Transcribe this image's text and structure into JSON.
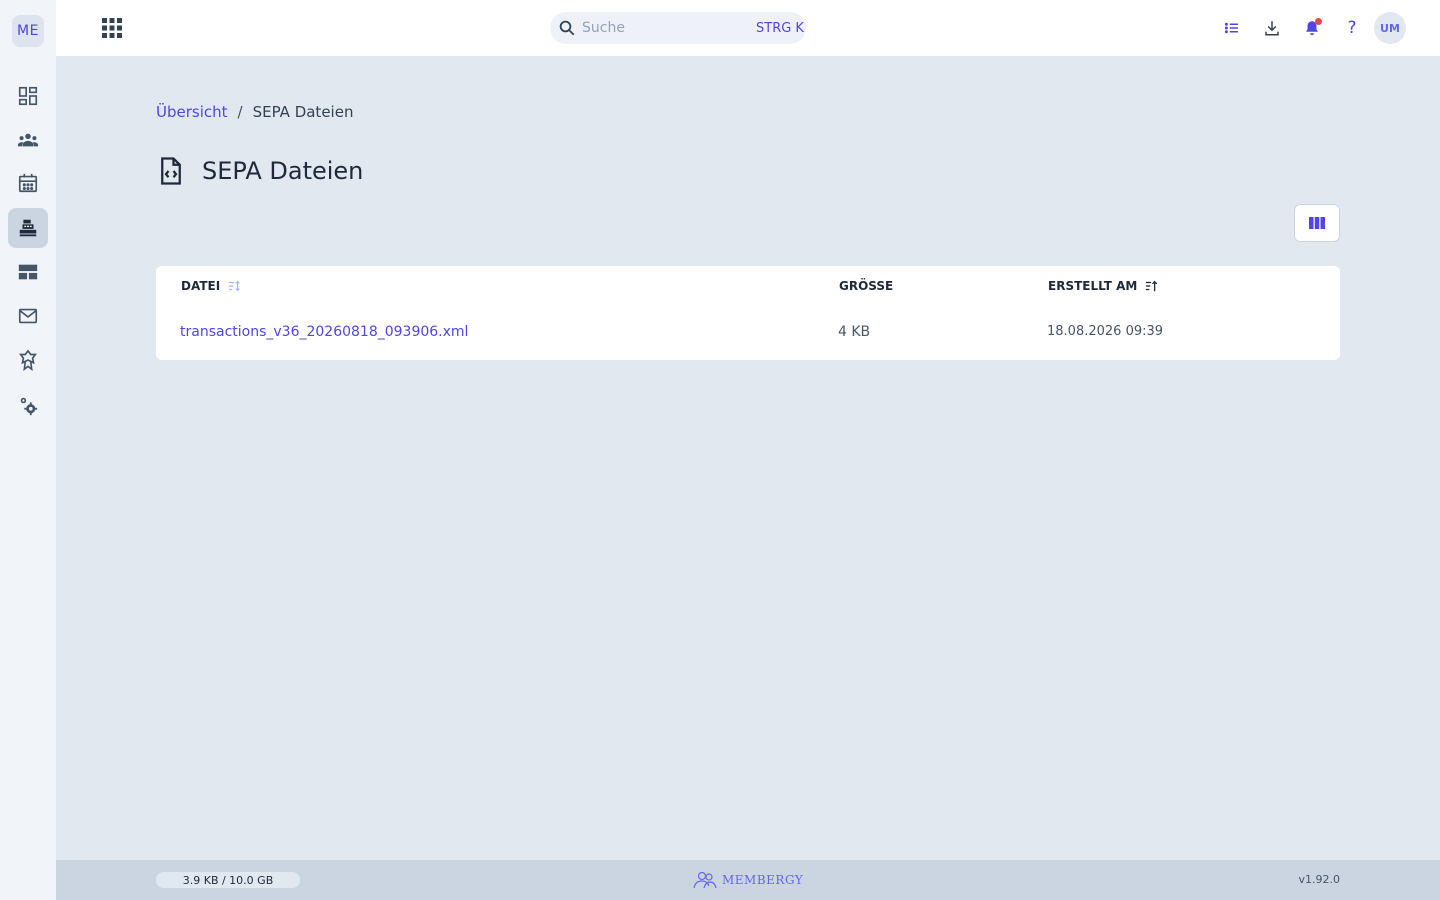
{
  "sidebar": {
    "logo": "ME",
    "items": [
      {
        "icon": "dashboard-icon"
      },
      {
        "icon": "members-icon"
      },
      {
        "icon": "calendar-icon"
      },
      {
        "icon": "cash-register-icon",
        "active": true
      },
      {
        "icon": "layout-icon"
      },
      {
        "icon": "mail-icon"
      },
      {
        "icon": "award-icon"
      },
      {
        "icon": "settings-icon"
      }
    ]
  },
  "topbar": {
    "search": {
      "placeholder": "Suche",
      "shortcut": "STRG K"
    },
    "help": "?",
    "avatar": "UM"
  },
  "breadcrumb": {
    "home": "Übersicht",
    "separator": "/",
    "current": "SEPA Dateien"
  },
  "page": {
    "title": "SEPA Dateien"
  },
  "table": {
    "columns": {
      "file": "DATEI",
      "size": "GRÖSSE",
      "created": "ERSTELLT AM"
    },
    "rows": [
      {
        "file": "transactions_v36_20260818_093906.xml",
        "size": "4 KB",
        "created": "18.08.2026 09:39"
      }
    ]
  },
  "footer": {
    "storage": "3.9 KB / 10.0 GB",
    "brand": "MEMBERGY",
    "version": "v1.92.0"
  },
  "colors": {
    "accent": "#4f46e5",
    "background": "#e2e8f0",
    "sidebar": "#f1f5f9",
    "notification": "#ef4444"
  }
}
